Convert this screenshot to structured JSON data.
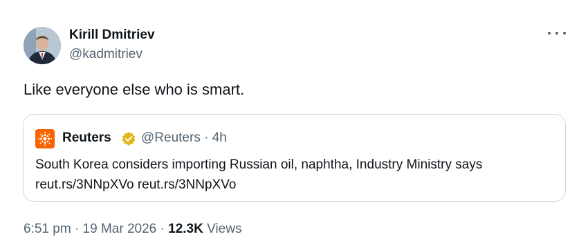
{
  "author": {
    "name": "Kirill Dmitriev",
    "handle": "@kadmitriev"
  },
  "tweet": {
    "text": "Like everyone else who is smart."
  },
  "quoted": {
    "name": "Reuters",
    "handle": "@Reuters",
    "separator": " · ",
    "time": "4h",
    "text": "South Korea considers importing Russian oil, naphtha, Industry Ministry says",
    "links": "reut.rs/3NNpXVo reut.rs/3NNpXVo",
    "logo_color": "#fa6400",
    "badge_color": "#e2b719",
    "badge_icon": "verified-badge-icon",
    "logo_icon": "reuters-logo-icon"
  },
  "footer": {
    "time": "6:51 pm",
    "sep1": " · ",
    "date": "19 Mar 2026",
    "sep2": " · ",
    "views_count": "12.3K",
    "views_label": " Views"
  },
  "menu_icon": "more-options-icon"
}
